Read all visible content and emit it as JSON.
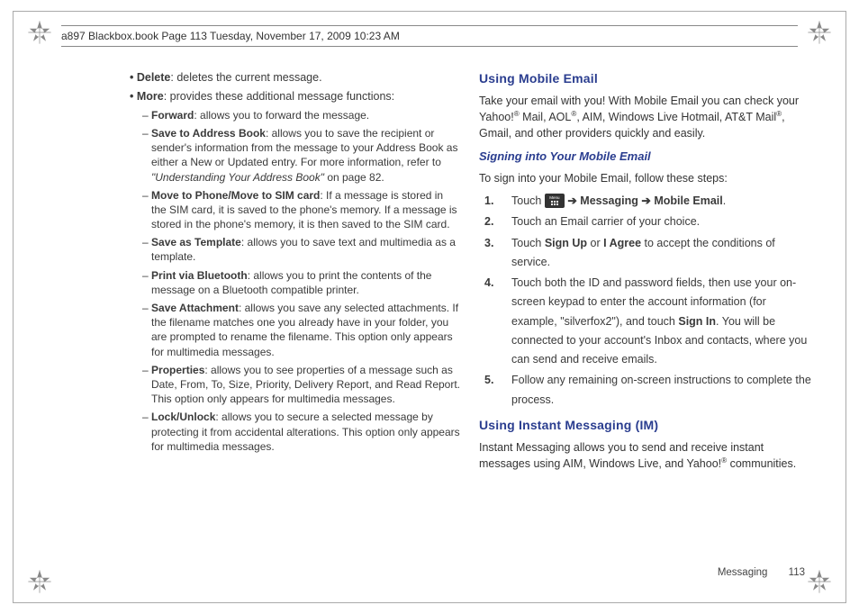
{
  "header": {
    "text": "a897 Blackbox.book  Page 113  Tuesday, November 17, 2009  10:23 AM"
  },
  "left": {
    "b1a_bold": "Delete",
    "b1a_rest": ": deletes the current message.",
    "b1b_bold": "More",
    "b1b_rest": ": provides these additional message functions:",
    "f_bold": "Forward",
    "f_rest": ": allows you to forward the message.",
    "sab_bold": "Save to Address Book",
    "sab_rest_1": ": allows you to save the recipient or sender's information from the message to your Address Book as either a New or Updated entry. For more information, refer to ",
    "sab_ref": "\"Understanding Your Address Book\"",
    "sab_rest_2": "  on page 82.",
    "mv_bold": "Move to Phone/Move to SIM card",
    "mv_rest": ": If a message is stored in the SIM card, it is saved to the phone's memory. If a message is stored in the phone's memory, it is then saved to the SIM card.",
    "st_bold": "Save as Template",
    "st_rest": ": allows you to save text and multimedia as a template.",
    "pb_bold": "Print via Bluetooth",
    "pb_rest": ": allows you to print the contents of the message on a Bluetooth compatible printer.",
    "sa_bold": "Save Attachment",
    "sa_rest": ": allows you save any selected attachments. If the filename matches one you already have in your folder, you are prompted to rename the filename. This option only appears for multimedia messages.",
    "pr_bold": "Properties",
    "pr_rest": ": allows you to see properties of a message such as Date, From, To, Size, Priority, Delivery Report, and Read Report. This option only appears for multimedia messages.",
    "lu_bold": "Lock/Unlock",
    "lu_rest": ": allows you to secure a selected message by protecting it from accidental alterations. This option only appears for multimedia messages."
  },
  "right": {
    "h1": "Using Mobile Email",
    "p1a": "Take your email with you! With Mobile Email you can check your Yahoo!",
    "p1b": " Mail, AOL",
    "p1c": ", AIM, Windows Live Hotmail, AT&T Mail",
    "p1d": ", Gmail, and other providers quickly and easily.",
    "h2a": "Signing into Your Mobile Email",
    "p2": "To sign into your Mobile Email, follow these steps:",
    "s1_num": "1.",
    "s1_a": "Touch ",
    "s1_arrow": " ➔ ",
    "s1_b1": "Messaging",
    "s1_b2": " ➔ ",
    "s1_b3": "Mobile Email",
    "s1_end": ".",
    "s2_num": "2.",
    "s2_body": "Touch an Email carrier of your choice.",
    "s3_num": "3.",
    "s3_a": "Touch ",
    "s3_b1": "Sign Up",
    "s3_mid": " or ",
    "s3_b2": "I Agree",
    "s3_end": " to accept the conditions of service.",
    "s4_num": "4.",
    "s4_a": "Touch both the ID and password fields, then use your on-screen keypad to enter the account information (for example, \"silverfox2\"), and touch ",
    "s4_b": "Sign In",
    "s4_c": ". You will be connected to your account's Inbox and contacts, where you can send and receive emails.",
    "s5_num": "5.",
    "s5_body": "Follow any remaining on-screen instructions to complete the process.",
    "h1b": "Using Instant Messaging (IM)",
    "p3a": "Instant Messaging allows you to send and receive instant messages using AIM, Windows Live, and Yahoo!",
    "p3b": " communities."
  },
  "footer": {
    "section": "Messaging",
    "page": "113"
  },
  "reg": "®"
}
